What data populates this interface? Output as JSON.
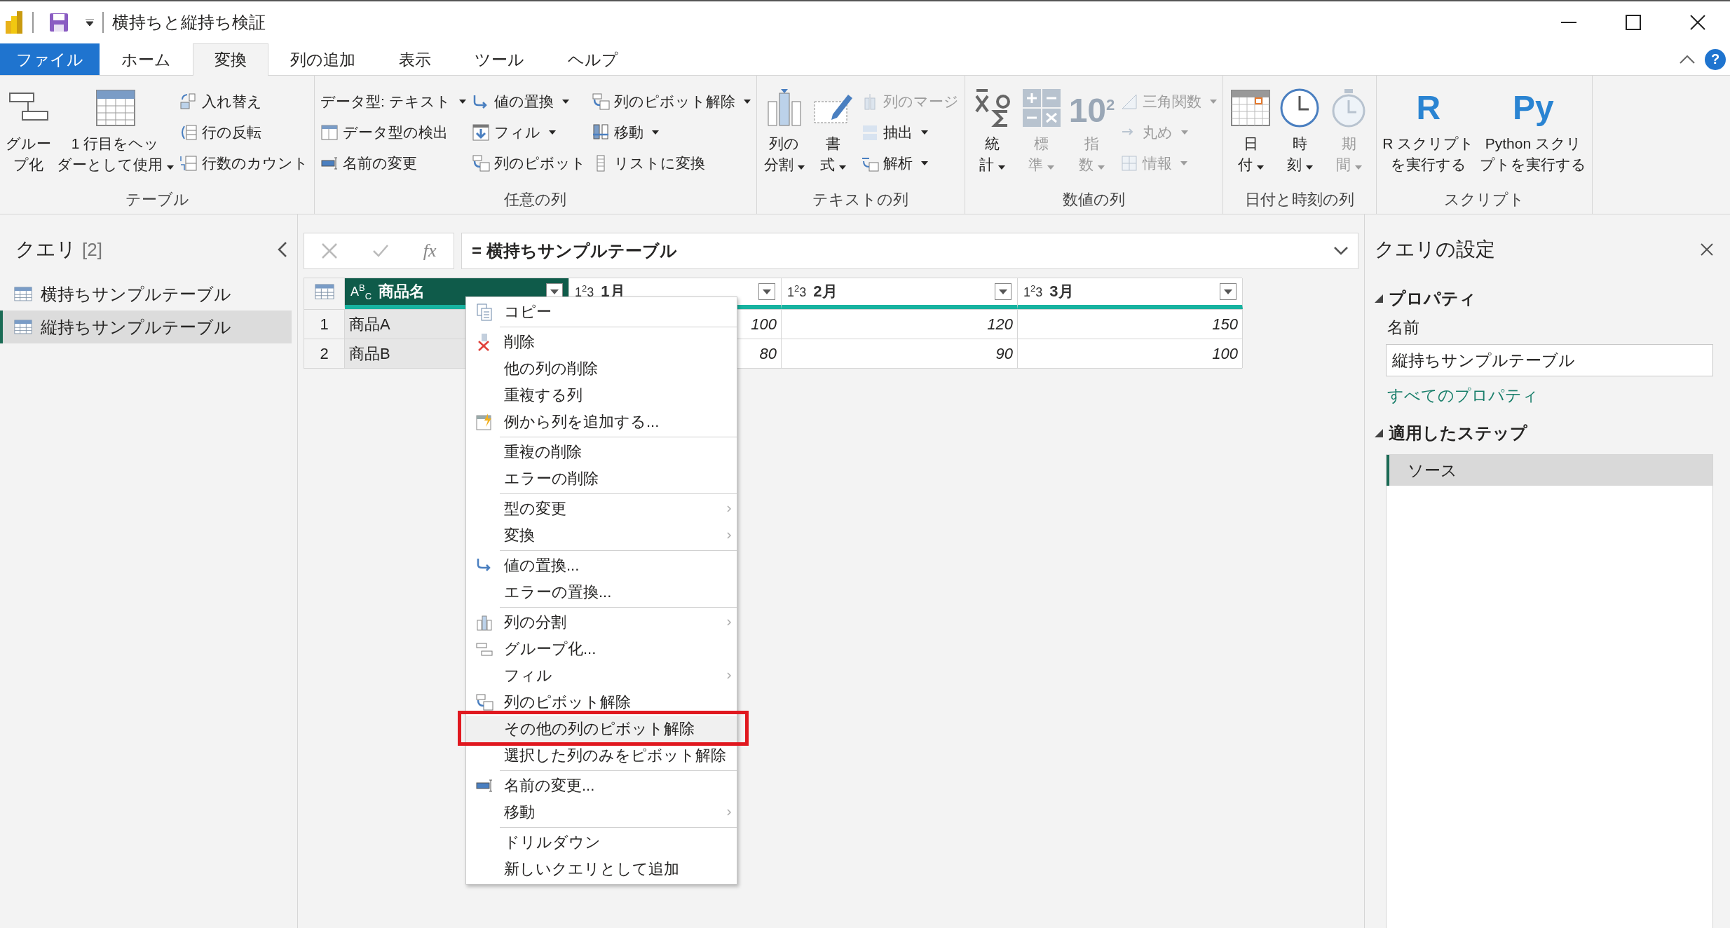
{
  "window": {
    "title": "横持ちと縦持ち検証"
  },
  "tabs": [
    {
      "label": "ファイル",
      "kind": "file",
      "selected": false
    },
    {
      "label": "ホーム",
      "kind": "tab",
      "selected": false
    },
    {
      "label": "変換",
      "kind": "tab",
      "selected": true
    },
    {
      "label": "列の追加",
      "kind": "tab",
      "selected": false
    },
    {
      "label": "表示",
      "kind": "tab",
      "selected": false
    },
    {
      "label": "ツール",
      "kind": "tab",
      "selected": false
    },
    {
      "label": "ヘルプ",
      "kind": "tab",
      "selected": false
    }
  ],
  "help": "?",
  "ribbon_groups": [
    {
      "label": "テーブル",
      "columns": [
        {
          "kind": "large",
          "lines": [
            "グルー",
            "プ化"
          ],
          "dropdown": false,
          "disabled": false
        },
        {
          "kind": "large",
          "lines": [
            "1 行目をヘッ",
            "ダーとして使用"
          ],
          "dropdown": true,
          "disabled": false
        },
        {
          "kind": "stack",
          "items": [
            {
              "label": "入れ替え",
              "dropdown": false,
              "disabled": false
            },
            {
              "label": "行の反転",
              "dropdown": false,
              "disabled": false
            },
            {
              "label": "行数のカウント",
              "dropdown": false,
              "disabled": false
            }
          ]
        }
      ]
    },
    {
      "label": "任意の列",
      "columns": [
        {
          "kind": "stack",
          "items": [
            {
              "label": "データ型: テキスト",
              "dropdown": true,
              "disabled": false
            },
            {
              "label": "データ型の検出",
              "dropdown": false,
              "disabled": false
            },
            {
              "label": "名前の変更",
              "dropdown": false,
              "disabled": false
            }
          ]
        },
        {
          "kind": "stack",
          "items": [
            {
              "label": "値の置換",
              "dropdown": true,
              "disabled": false
            },
            {
              "label": "フィル",
              "dropdown": true,
              "disabled": false
            },
            {
              "label": "列のピボット",
              "dropdown": false,
              "disabled": false
            }
          ]
        },
        {
          "kind": "stack",
          "items": [
            {
              "label": "列のピボット解除",
              "dropdown": true,
              "disabled": false
            },
            {
              "label": "移動",
              "dropdown": true,
              "disabled": false
            },
            {
              "label": "リストに変換",
              "dropdown": false,
              "disabled": false
            }
          ]
        }
      ]
    },
    {
      "label": "テキストの列",
      "columns": [
        {
          "kind": "large",
          "lines": [
            "列の",
            "分割"
          ],
          "dropdown": true,
          "disabled": false
        },
        {
          "kind": "large",
          "lines": [
            "書",
            "式"
          ],
          "dropdown": true,
          "disabled": false
        },
        {
          "kind": "stack",
          "items": [
            {
              "label": "列のマージ",
              "dropdown": false,
              "disabled": true
            },
            {
              "label": "抽出",
              "dropdown": true,
              "disabled": false
            },
            {
              "label": "解析",
              "dropdown": true,
              "disabled": false
            }
          ]
        }
      ]
    },
    {
      "label": "数値の列",
      "columns": [
        {
          "kind": "large",
          "lines": [
            "統",
            "計"
          ],
          "dropdown": true,
          "disabled": false
        },
        {
          "kind": "large",
          "lines": [
            "標",
            "準"
          ],
          "dropdown": true,
          "disabled": true
        },
        {
          "kind": "large",
          "lines": [
            "指",
            "数"
          ],
          "dropdown": true,
          "disabled": true,
          "logo": "10$^{2}$"
        },
        {
          "kind": "stack",
          "items": [
            {
              "label": "三角関数",
              "dropdown": true,
              "disabled": true
            },
            {
              "label": "丸め",
              "dropdown": true,
              "disabled": true
            },
            {
              "label": "情報",
              "dropdown": true,
              "disabled": true
            }
          ]
        }
      ]
    },
    {
      "label": "日付と時刻の列",
      "columns": [
        {
          "kind": "large",
          "lines": [
            "日",
            "付"
          ],
          "dropdown": true,
          "disabled": false
        },
        {
          "kind": "large",
          "lines": [
            "時",
            "刻"
          ],
          "dropdown": true,
          "disabled": false
        },
        {
          "kind": "large",
          "lines": [
            "期",
            "間"
          ],
          "dropdown": true,
          "disabled": true
        }
      ]
    },
    {
      "label": "スクリプト",
      "columns": [
        {
          "kind": "large",
          "lines": [
            "R スクリプト",
            "を実行する"
          ],
          "dropdown": false,
          "disabled": false,
          "logo": "R"
        },
        {
          "kind": "large",
          "lines": [
            "Python スクリ",
            "プトを実行する"
          ],
          "dropdown": false,
          "disabled": false,
          "logo": "Py"
        }
      ]
    }
  ],
  "queries": {
    "title": "クエリ",
    "count": "[2]",
    "items": [
      {
        "label": "横持ちサンプルテーブル",
        "selected": false
      },
      {
        "label": "縦持ちサンプルテーブル",
        "selected": true
      }
    ]
  },
  "formula_bar": {
    "fx": "fx",
    "formula": "= 横持ちサンプルテーブル"
  },
  "table": {
    "columns": [
      {
        "type": "A$^{B}$$_{C}$",
        "name": "商品名",
        "selected": true,
        "kind": "text"
      },
      {
        "type": "1$^{2}$3",
        "name": "1月",
        "selected": false,
        "kind": "number"
      },
      {
        "type": "1$^{2}$3",
        "name": "2月",
        "selected": false,
        "kind": "number"
      },
      {
        "type": "1$^{2}$3",
        "name": "3月",
        "selected": false,
        "kind": "number"
      }
    ],
    "rows": [
      {
        "number": "1",
        "cells": [
          "商品A",
          "100",
          "120",
          "150"
        ]
      },
      {
        "number": "2",
        "cells": [
          "商品B",
          "80",
          "90",
          "100"
        ]
      }
    ]
  },
  "context_menu": {
    "sections": [
      [
        {
          "label": "コピー",
          "submenu": false,
          "highlighted": false,
          "boxed": false
        }
      ],
      [
        {
          "label": "削除",
          "submenu": false,
          "highlighted": false,
          "boxed": false
        },
        {
          "label": "他の列の削除",
          "submenu": false,
          "highlighted": false,
          "boxed": false
        },
        {
          "label": "重複する列",
          "submenu": false,
          "highlighted": false,
          "boxed": false
        },
        {
          "label": "例から列を追加する...",
          "submenu": false,
          "highlighted": false,
          "boxed": false
        }
      ],
      [
        {
          "label": "重複の削除",
          "submenu": false,
          "highlighted": false,
          "boxed": false
        },
        {
          "label": "エラーの削除",
          "submenu": false,
          "highlighted": false,
          "boxed": false
        }
      ],
      [
        {
          "label": "型の変更",
          "submenu": true,
          "highlighted": false,
          "boxed": false
        },
        {
          "label": "変換",
          "submenu": true,
          "highlighted": false,
          "boxed": false
        }
      ],
      [
        {
          "label": "値の置換...",
          "submenu": false,
          "highlighted": false,
          "boxed": false
        },
        {
          "label": "エラーの置換...",
          "submenu": false,
          "highlighted": false,
          "boxed": false
        }
      ],
      [
        {
          "label": "列の分割",
          "submenu": true,
          "highlighted": false,
          "boxed": false
        },
        {
          "label": "グループ化...",
          "submenu": false,
          "highlighted": false,
          "boxed": false
        },
        {
          "label": "フィル",
          "submenu": true,
          "highlighted": false,
          "boxed": false
        },
        {
          "label": "列のピボット解除",
          "submenu": false,
          "highlighted": false,
          "boxed": false
        },
        {
          "label": "その他の列のピボット解除",
          "submenu": false,
          "highlighted": true,
          "boxed": true
        },
        {
          "label": "選択した列のみをピボット解除",
          "submenu": false,
          "highlighted": false,
          "boxed": false
        }
      ],
      [
        {
          "label": "名前の変更...",
          "submenu": false,
          "highlighted": false,
          "boxed": false
        },
        {
          "label": "移動",
          "submenu": true,
          "highlighted": false,
          "boxed": false
        }
      ],
      [
        {
          "label": "ドリルダウン",
          "submenu": false,
          "highlighted": false,
          "boxed": false
        },
        {
          "label": "新しいクエリとして追加",
          "submenu": false,
          "highlighted": false,
          "boxed": false
        }
      ]
    ]
  },
  "settings": {
    "title": "クエリの設定",
    "properties": {
      "title": "プロパティ",
      "expanded": true,
      "name_label": "名前",
      "name_value": "縦持ちサンプルテーブル",
      "link": "すべてのプロパティ"
    },
    "steps": {
      "title": "適用したステップ",
      "expanded": true,
      "items": [
        {
          "label": "ソース",
          "selected": true
        }
      ]
    }
  }
}
